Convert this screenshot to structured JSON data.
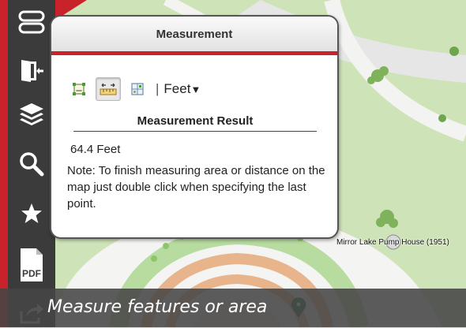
{
  "panel": {
    "title": "Measurement",
    "unit": "Feet",
    "unit_arrow": "▼",
    "unit_separator": "|",
    "result_heading": "Measurement Result",
    "result_value": "64.4 Feet",
    "note": "Note: To finish measuring area or distance on the map just double click when specifying the last point.",
    "tools": [
      {
        "name": "area-tool",
        "icon": "area-measure-icon",
        "active": false
      },
      {
        "name": "distance-tool",
        "icon": "distance-measure-icon",
        "active": true
      },
      {
        "name": "location-tool",
        "icon": "location-measure-icon",
        "active": false
      }
    ]
  },
  "toolbar": {
    "items": [
      {
        "icon": "toggle-icon"
      },
      {
        "icon": "exit-icon"
      },
      {
        "icon": "layers-icon"
      },
      {
        "icon": "search-icon"
      },
      {
        "icon": "star-icon"
      },
      {
        "icon": "pdf-icon",
        "text": "PDF"
      },
      {
        "icon": "share-icon"
      }
    ]
  },
  "map": {
    "label": "Mirror Lake Pump House (1951)"
  },
  "caption": "Measure features or area",
  "colors": {
    "accent": "#c8232b",
    "toolbar": "#3b3b3b",
    "map_green": "#cfe3b8",
    "path": "#f3f3f1"
  }
}
